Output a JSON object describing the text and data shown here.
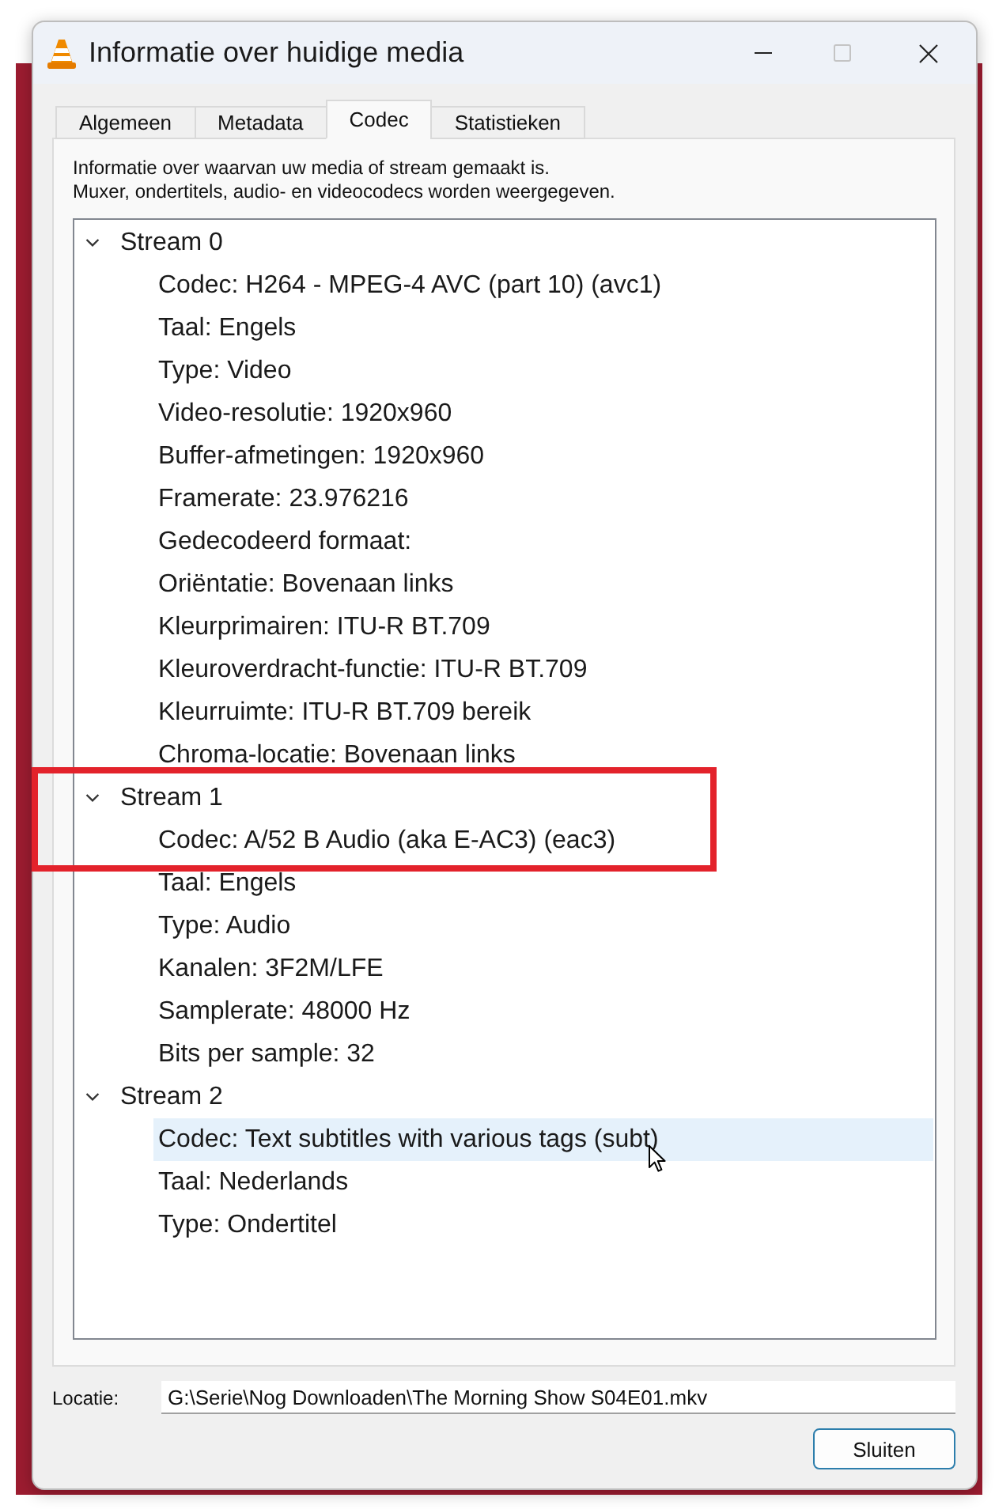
{
  "window": {
    "title": "Informatie over huidige media",
    "maximize_disabled": true
  },
  "tabs": [
    {
      "label": "Algemeen",
      "selected": false
    },
    {
      "label": "Metadata",
      "selected": false
    },
    {
      "label": "Codec",
      "selected": true
    },
    {
      "label": "Statistieken",
      "selected": false
    }
  ],
  "description": [
    "Informatie over waarvan uw media of stream gemaakt is.",
    "Muxer, ondertitels, audio- en videocodecs worden weergegeven."
  ],
  "streams": [
    {
      "label": "Stream 0",
      "expanded": true,
      "outlined": false,
      "children": [
        {
          "text": "Codec: H264 - MPEG-4 AVC (part 10) (avc1)",
          "highlighted": false
        },
        {
          "text": "Taal: Engels",
          "highlighted": false
        },
        {
          "text": "Type: Video",
          "highlighted": false
        },
        {
          "text": "Video-resolutie: 1920x960",
          "highlighted": false
        },
        {
          "text": "Buffer-afmetingen: 1920x960",
          "highlighted": false
        },
        {
          "text": "Framerate: 23.976216",
          "highlighted": false
        },
        {
          "text": "Gedecodeerd formaat:",
          "highlighted": false
        },
        {
          "text": "Oriëntatie: Bovenaan links",
          "highlighted": false
        },
        {
          "text": "Kleurprimairen: ITU-R BT.709",
          "highlighted": false
        },
        {
          "text": "Kleuroverdracht-functie: ITU-R BT.709",
          "highlighted": false
        },
        {
          "text": "Kleurruimte: ITU-R BT.709 bereik",
          "highlighted": false
        },
        {
          "text": "Chroma-locatie: Bovenaan links",
          "highlighted": false
        }
      ]
    },
    {
      "label": "Stream 1",
      "expanded": true,
      "outlined": true,
      "children": [
        {
          "text": "Codec: A/52 B Audio (aka E-AC3) (eac3)",
          "highlighted": false
        },
        {
          "text": "Taal: Engels",
          "highlighted": false
        },
        {
          "text": "Type: Audio",
          "highlighted": false
        },
        {
          "text": "Kanalen: 3F2M/LFE",
          "highlighted": false
        },
        {
          "text": "Samplerate: 48000 Hz",
          "highlighted": false
        },
        {
          "text": "Bits per sample: 32",
          "highlighted": false
        }
      ]
    },
    {
      "label": "Stream 2",
      "expanded": true,
      "outlined": false,
      "children": [
        {
          "text": "Codec: Text subtitles with various tags (subt)",
          "highlighted": true
        },
        {
          "text": "Taal: Nederlands",
          "highlighted": false
        },
        {
          "text": "Type: Ondertitel",
          "highlighted": false
        }
      ]
    }
  ],
  "location": {
    "label": "Locatie:",
    "value": "G:\\Serie\\Nog Downloaden\\The Morning Show S04E01.mkv"
  },
  "buttons": [
    {
      "label": "Sluiten"
    }
  ]
}
